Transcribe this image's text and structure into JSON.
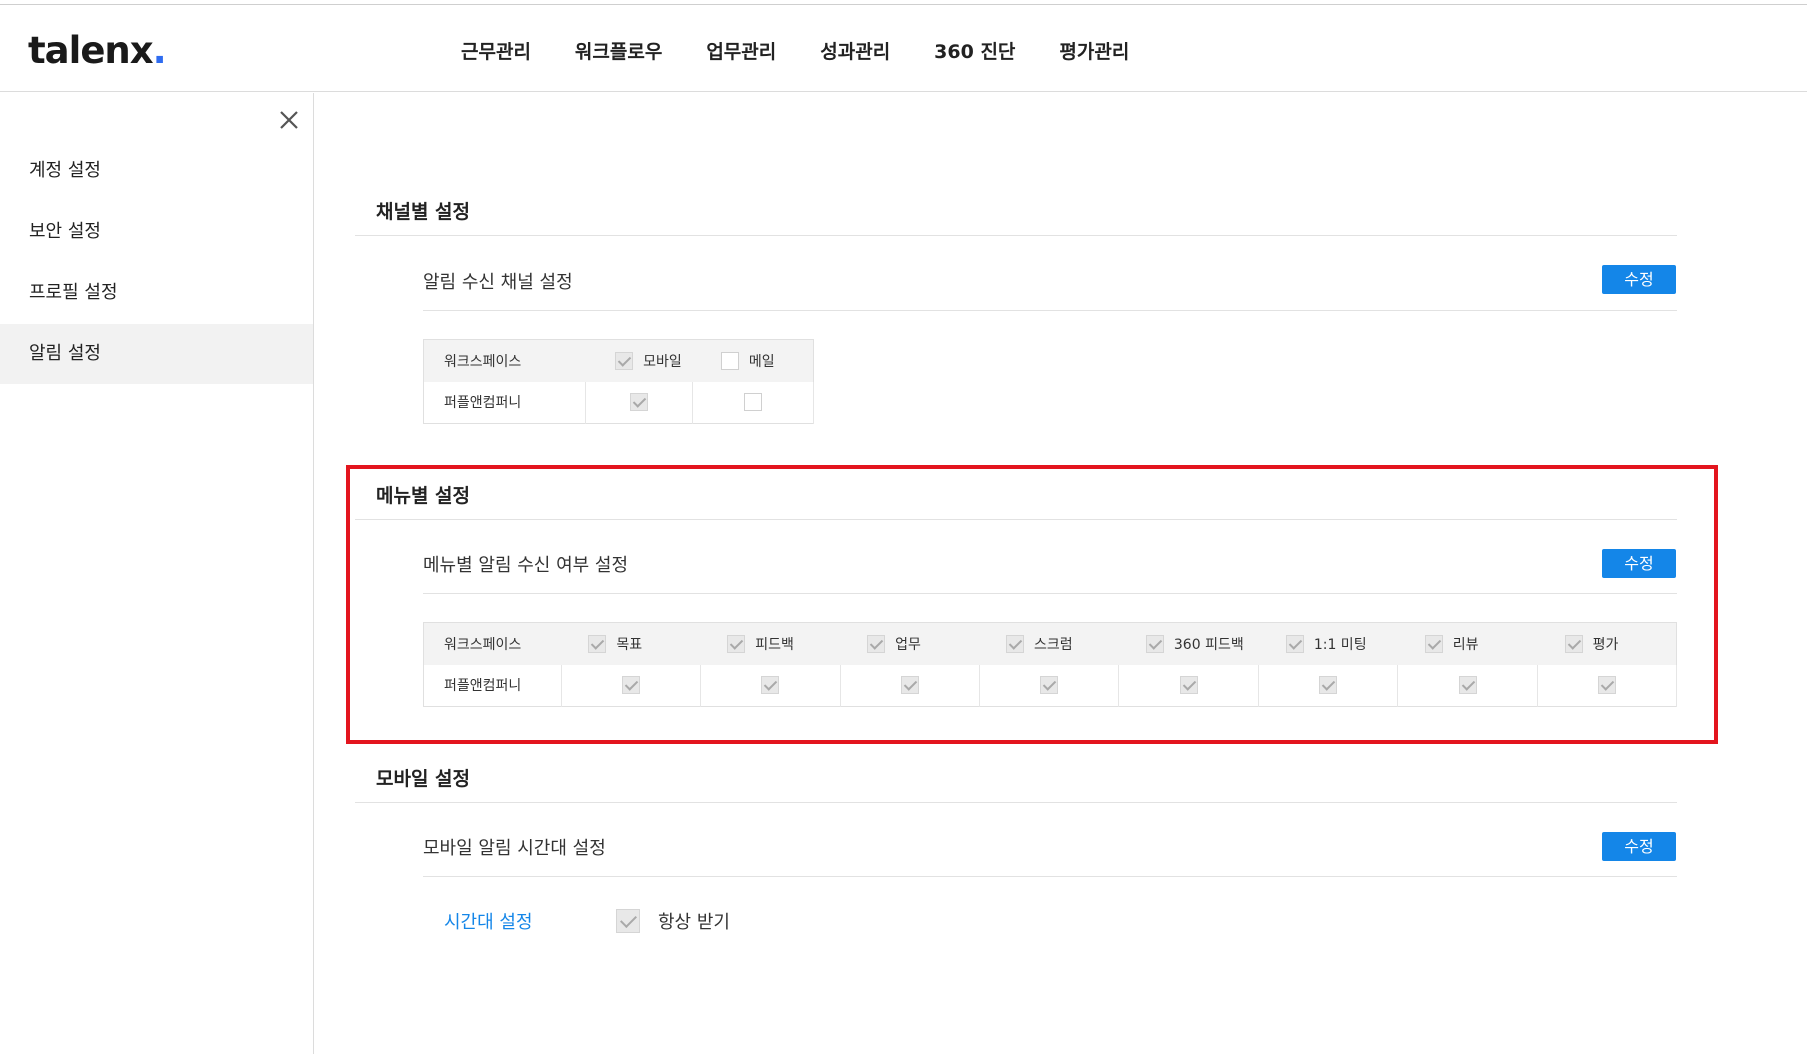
{
  "header": {
    "logo_text": "talenx",
    "logo_dot": ".",
    "nav": [
      "근무관리",
      "워크플로우",
      "업무관리",
      "성과관리",
      "360 진단",
      "평가관리"
    ]
  },
  "sidebar": {
    "items": [
      {
        "label": "계정 설정",
        "active": false
      },
      {
        "label": "보안 설정",
        "active": false
      },
      {
        "label": "프로필 설정",
        "active": false
      },
      {
        "label": "알림 설정",
        "active": true
      }
    ]
  },
  "channel_section": {
    "title": "채널별 설정",
    "subtitle": "알림 수신 채널 설정",
    "edit_label": "수정",
    "table": {
      "workspace_header": "워크스페이스",
      "columns": [
        {
          "label": "모바일",
          "header_checked": true
        },
        {
          "label": "메일",
          "header_checked": false
        }
      ],
      "rows": [
        {
          "name": "퍼플앤컴퍼니",
          "values": [
            true,
            false
          ]
        }
      ]
    }
  },
  "menu_section": {
    "title": "메뉴별 설정",
    "subtitle": "메뉴별 알림 수신 여부 설정",
    "edit_label": "수정",
    "table": {
      "workspace_header": "워크스페이스",
      "columns": [
        {
          "label": "목표",
          "header_checked": true
        },
        {
          "label": "피드백",
          "header_checked": true
        },
        {
          "label": "업무",
          "header_checked": true
        },
        {
          "label": "스크럼",
          "header_checked": true
        },
        {
          "label": "360 피드백",
          "header_checked": true
        },
        {
          "label": "1:1 미팅",
          "header_checked": true
        },
        {
          "label": "리뷰",
          "header_checked": true
        },
        {
          "label": "평가",
          "header_checked": true
        }
      ],
      "rows": [
        {
          "name": "퍼플앤컴퍼니",
          "values": [
            true,
            true,
            true,
            true,
            true,
            true,
            true,
            true
          ]
        }
      ]
    }
  },
  "mobile_section": {
    "title": "모바일 설정",
    "subtitle": "모바일 알림 시간대 설정",
    "edit_label": "수정",
    "time_link": "시간대 설정",
    "always_label": "항상 받기",
    "always_checked": true
  },
  "colors": {
    "accent": "#1486e8",
    "highlight": "#e3151e",
    "logo_dot": "#2f6cf0"
  }
}
